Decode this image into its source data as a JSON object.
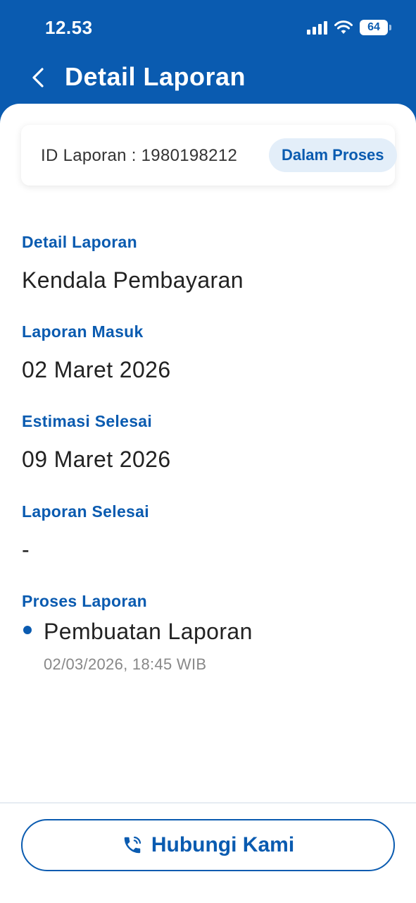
{
  "status_bar": {
    "time": "12.53",
    "battery": "64"
  },
  "header": {
    "title": "Detail Laporan"
  },
  "report": {
    "id_text": "ID Laporan : 1980198212",
    "status": "Dalam Proses"
  },
  "fields": [
    {
      "label": "Detail Laporan",
      "value": "Kendala Pembayaran"
    },
    {
      "label": "Laporan Masuk",
      "value": "02 Maret 2026"
    },
    {
      "label": "Estimasi Selesai",
      "value": "09 Maret 2026"
    },
    {
      "label": "Laporan Selesai",
      "value": "-"
    }
  ],
  "process": {
    "label": "Proses Laporan",
    "items": [
      {
        "title": "Pembuatan Laporan",
        "time": "02/03/2026, 18:45 WIB"
      }
    ]
  },
  "footer": {
    "contact_label": "Hubungi Kami"
  },
  "colors": {
    "primary": "#0a5bb0",
    "badge_bg": "#e3eef9"
  },
  "icons": [
    "back-arrow-icon",
    "signal-icon",
    "wifi-icon",
    "battery-icon",
    "phone-icon"
  ]
}
